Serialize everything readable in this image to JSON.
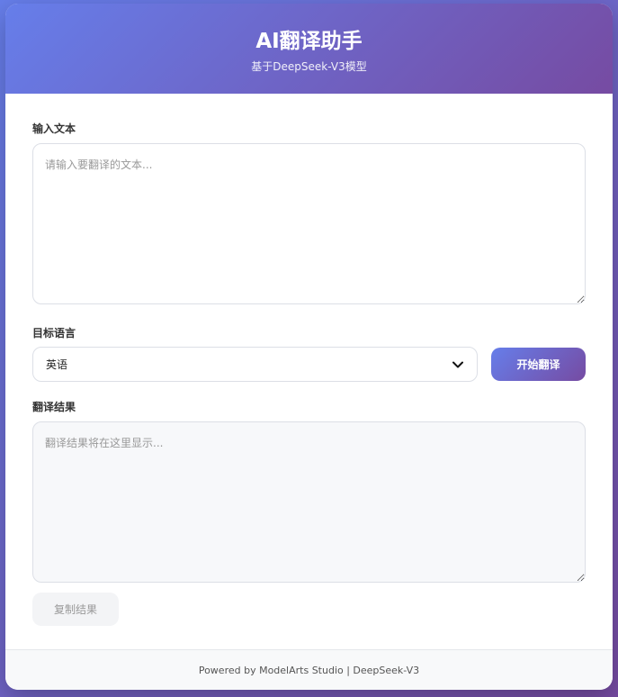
{
  "header": {
    "title": "AI翻译助手",
    "subtitle": "基于DeepSeek-V3模型"
  },
  "input": {
    "label": "输入文本",
    "placeholder": "请输入要翻译的文本..."
  },
  "language": {
    "label": "目标语言",
    "selected": "英语"
  },
  "translate_button": "开始翻译",
  "result": {
    "label": "翻译结果",
    "placeholder": "翻译结果将在这里显示..."
  },
  "copy_button": "复制结果",
  "footer": "Powered by ModelArts Studio | DeepSeek-V3",
  "colors": {
    "accent_start": "#667eea",
    "accent_end": "#764ba2"
  }
}
